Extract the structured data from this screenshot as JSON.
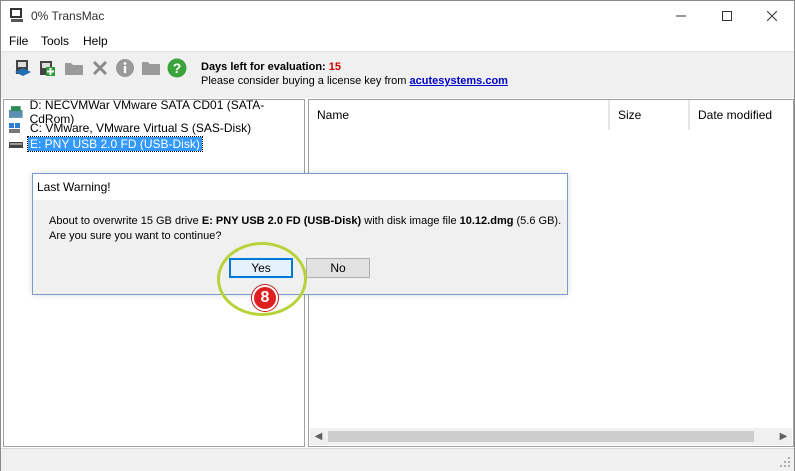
{
  "window": {
    "title": "0% TransMac"
  },
  "menu": [
    "File",
    "Tools",
    "Help"
  ],
  "toolbar": {
    "icons": [
      "open-disk-image-icon",
      "restore-disk-image-icon",
      "folder-icon",
      "delete-icon",
      "info-icon",
      "folder-open-icon",
      "help-icon"
    ],
    "eval_label": "Days left for evaluation:",
    "eval_days": "15",
    "license_text": "Please consider buying a license key from",
    "license_link": "acutesystems.com"
  },
  "drives": [
    {
      "label": "D: NECVMWar VMware SATA CD01 (SATA-CdRom)",
      "icon": "cdrom-drive-icon",
      "selected": false
    },
    {
      "label": "C: VMware, VMware Virtual S (SAS-Disk)",
      "icon": "hard-disk-icon",
      "selected": false
    },
    {
      "label": "E: PNY USB 2.0 FD (USB-Disk)",
      "icon": "usb-disk-icon",
      "selected": true
    }
  ],
  "file_list": {
    "columns": [
      "Name",
      "Size",
      "Date modified"
    ]
  },
  "dialog": {
    "title": "Last Warning!",
    "msg_prefix": "About to overwrite 15 GB drive",
    "msg_drive": "E: PNY USB 2.0 FD (USB-Disk)",
    "msg_mid": "with disk image file",
    "msg_file": "10.12.dmg",
    "msg_suffix": "(5.6 GB).",
    "msg_line2": "Are you sure you want to continue?",
    "yes_label": "Yes",
    "no_label": "No"
  },
  "annotation": {
    "step_number": "8",
    "ring_color": "#b6d33a",
    "badge_color": "#e02020"
  }
}
